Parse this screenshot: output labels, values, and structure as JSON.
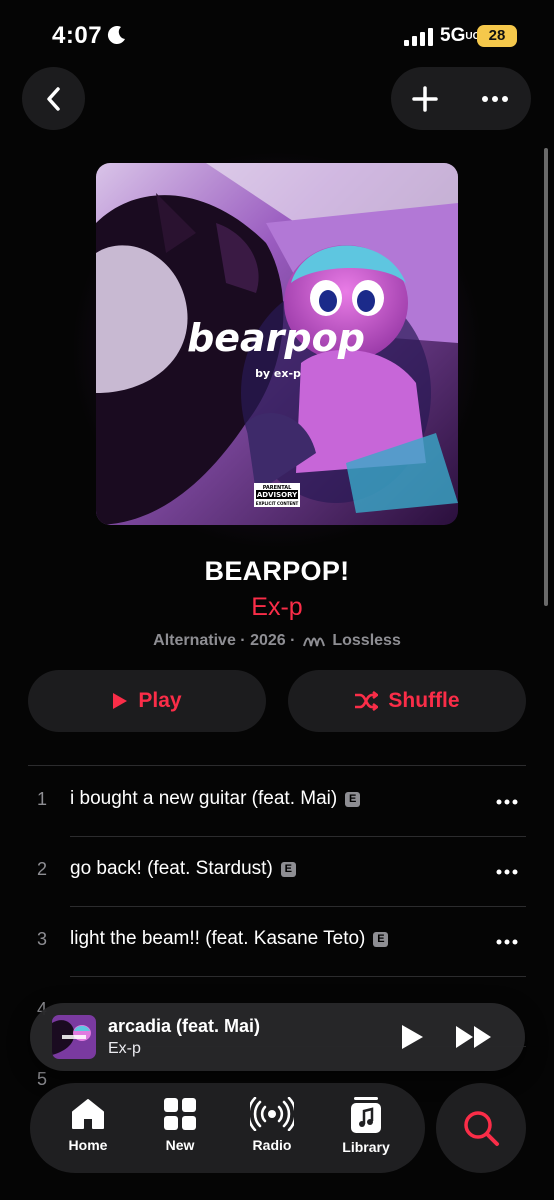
{
  "status_bar": {
    "time": "4:07",
    "network": "5G",
    "network_sub": "UC",
    "battery": "28"
  },
  "album": {
    "title": "BEARPOP!",
    "artist": "Ex-p",
    "genre": "Alternative",
    "year": "2026",
    "quality": "Lossless",
    "artwork_title": "bearpop",
    "artwork_subtitle": "by ex-p",
    "advisory_line1": "PARENTAL",
    "advisory_line2": "ADVISORY",
    "advisory_line3": "EXPLICIT CONTENT"
  },
  "buttons": {
    "play": "Play",
    "shuffle": "Shuffle"
  },
  "tracks": [
    {
      "number": "1",
      "title": "i bought a new guitar (feat. Mai)",
      "explicit": "E"
    },
    {
      "number": "2",
      "title": "go back! (feat. Stardust)",
      "explicit": "E"
    },
    {
      "number": "3",
      "title": "light the beam!! (feat. Kasane Teto)",
      "explicit": "E"
    },
    {
      "number": "4",
      "title": "",
      "explicit": ""
    },
    {
      "number": "5",
      "title": "",
      "explicit": ""
    }
  ],
  "now_playing": {
    "title": "arcadia (feat. Mai)",
    "artist": "Ex-p"
  },
  "tabs": [
    {
      "label": "Home",
      "icon": "home-icon"
    },
    {
      "label": "New",
      "icon": "grid-icon"
    },
    {
      "label": "Radio",
      "icon": "radio-icon"
    },
    {
      "label": "Library",
      "icon": "library-icon"
    }
  ],
  "colors": {
    "accent": "#fa2d48",
    "background": "#050505",
    "surface": "#1c1c1e",
    "secondary_text": "#8e8e93"
  }
}
